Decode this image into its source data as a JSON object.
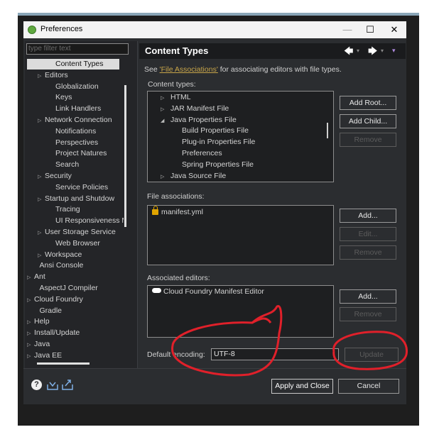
{
  "window": {
    "title": "Preferences",
    "minimize": "—",
    "maximize": "☐",
    "close": "✕"
  },
  "filter_placeholder": "type filter text",
  "tree": [
    {
      "label": "Content Types",
      "indent": 2,
      "selected": true
    },
    {
      "label": "Editors",
      "indent": 1,
      "arrow": "▷"
    },
    {
      "label": "Globalization",
      "indent": 2
    },
    {
      "label": "Keys",
      "indent": 2
    },
    {
      "label": "Link Handlers",
      "indent": 2
    },
    {
      "label": "Network Connection",
      "indent": 1,
      "arrow": "▷"
    },
    {
      "label": "Notifications",
      "indent": 2
    },
    {
      "label": "Perspectives",
      "indent": 2
    },
    {
      "label": "Project Natures",
      "indent": 2
    },
    {
      "label": "Search",
      "indent": 2
    },
    {
      "label": "Security",
      "indent": 1,
      "arrow": "▷"
    },
    {
      "label": "Service Policies",
      "indent": 2
    },
    {
      "label": "Startup and Shutdow",
      "indent": 1,
      "arrow": "▷"
    },
    {
      "label": "Tracing",
      "indent": 2
    },
    {
      "label": "UI Responsiveness M",
      "indent": 2
    },
    {
      "label": "User Storage Service",
      "indent": 1,
      "arrow": "▷"
    },
    {
      "label": "Web Browser",
      "indent": 2
    },
    {
      "label": "Workspace",
      "indent": 1,
      "arrow": "▷"
    },
    {
      "label": "Ansi Console",
      "indent": 0.5
    },
    {
      "label": "Ant",
      "indent": 0,
      "arrow": "▷"
    },
    {
      "label": "AspectJ Compiler",
      "indent": 0.5
    },
    {
      "label": "Cloud Foundry",
      "indent": 0,
      "arrow": "▷"
    },
    {
      "label": "Gradle",
      "indent": 0.5
    },
    {
      "label": "Help",
      "indent": 0,
      "arrow": "▷"
    },
    {
      "label": "Install/Update",
      "indent": 0,
      "arrow": "▷"
    },
    {
      "label": "Java",
      "indent": 0,
      "arrow": "▷"
    },
    {
      "label": "Java EE",
      "indent": 0,
      "arrow": "▷"
    }
  ],
  "header": {
    "title": "Content Types",
    "back": "🡄",
    "forward": "🡆",
    "menu": "▾"
  },
  "description": {
    "prefix": "See ",
    "link": "'File Associations'",
    "suffix": " for associating editors with file types."
  },
  "content_types_label": "Content types:",
  "content_types": [
    {
      "label": "HTML",
      "arrow": "▷",
      "indent": 1
    },
    {
      "label": "JAR Manifest File",
      "arrow": "▷",
      "indent": 1
    },
    {
      "label": "Java Properties File",
      "arrow": "◢",
      "indent": 1
    },
    {
      "label": "Build Properties File",
      "indent": 2
    },
    {
      "label": "Plug-in Properties File",
      "indent": 2
    },
    {
      "label": "Preferences",
      "indent": 2
    },
    {
      "label": "Spring Properties File",
      "indent": 2
    },
    {
      "label": "Java Source File",
      "arrow": "▷",
      "indent": 1
    }
  ],
  "buttons": {
    "add_root": "Add Root...",
    "add_child": "Add Child...",
    "remove_ct": "Remove",
    "add_assoc": "Add...",
    "edit_assoc": "Edit...",
    "remove_assoc": "Remove",
    "add_editor": "Add...",
    "remove_editor": "Remove",
    "update": "Update",
    "apply_close": "Apply and Close",
    "cancel": "Cancel"
  },
  "file_assoc_label": "File associations:",
  "file_assoc": [
    "manifest.yml"
  ],
  "editors_label": "Associated editors:",
  "editors": [
    "Cloud Foundry Manifest Editor"
  ],
  "encoding_label": "Default encoding:",
  "encoding_value": "UTF-8",
  "bottom_icons": {
    "help": "?",
    "import": "import-icon",
    "export": "export-icon"
  },
  "annotation_color": "#e0202a"
}
